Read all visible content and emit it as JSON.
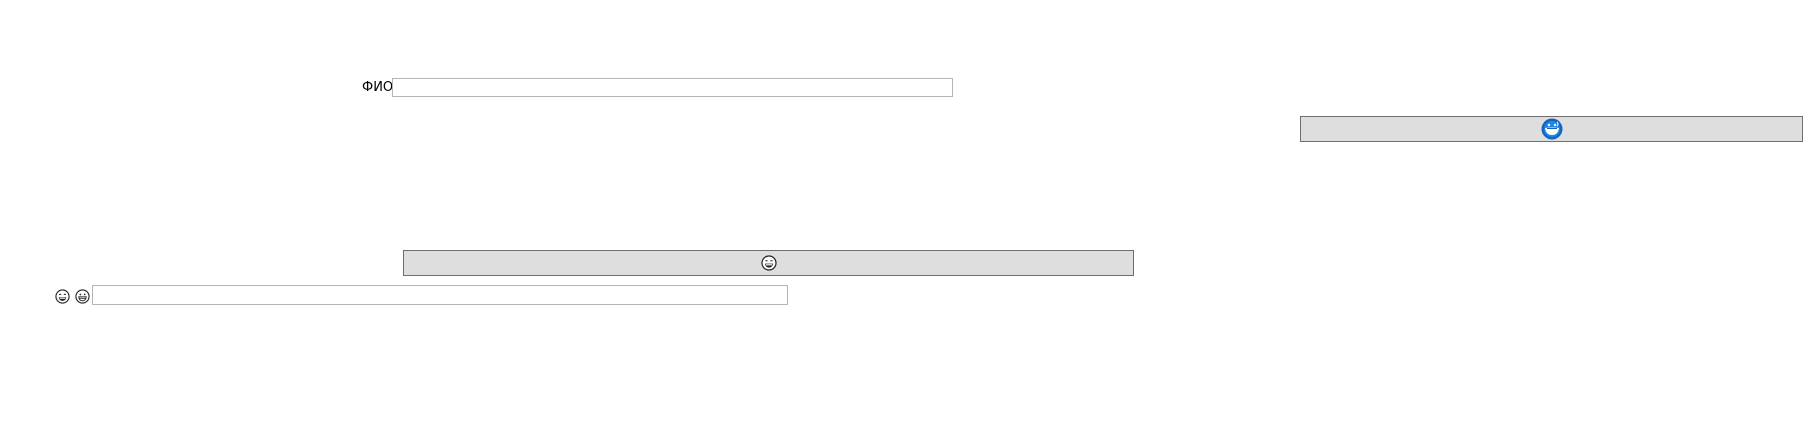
{
  "form": {
    "fio_label": "ФИО",
    "fio_value": "",
    "bottom_value": ""
  },
  "icons": {
    "top_button_icon": "blue-round-emoji-icon",
    "mid_button_icon": "grinning-sweat-face-icon",
    "bottom_icon_1": "grinning-sweat-face-icon",
    "bottom_icon_2": "grinning-face-icon"
  },
  "colors": {
    "button_bg": "#dedede",
    "button_border": "#6e6e6e",
    "input_border": "#b5b5b5",
    "accent_icon": "#1565c0"
  }
}
